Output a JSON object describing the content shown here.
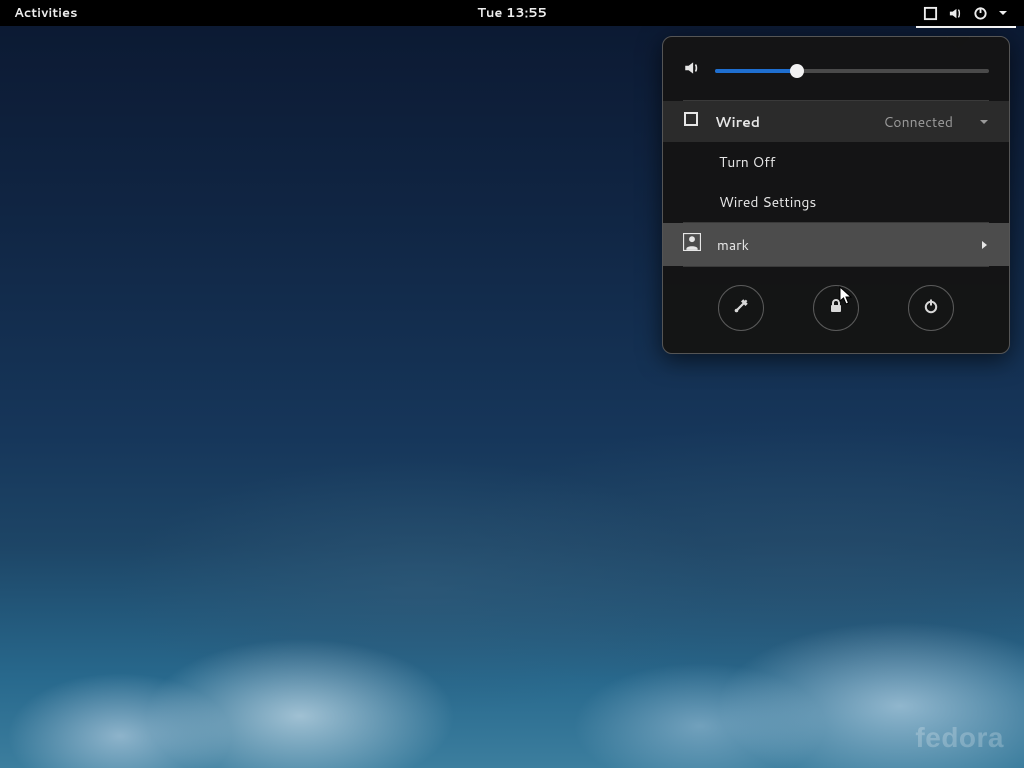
{
  "top_bar": {
    "activities_label": "Activities",
    "clock_text": "Tue 13:55",
    "tray_icons": [
      "network-icon",
      "volume-icon",
      "power-icon",
      "chevron-down-icon"
    ]
  },
  "system_menu": {
    "volume_percent": 30,
    "network": {
      "icon": "network-icon",
      "label": "Wired",
      "status": "Connected",
      "submenu": [
        "Turn Off",
        "Wired Settings"
      ]
    },
    "user": {
      "icon": "user-icon",
      "name": "mark"
    },
    "actions": {
      "settings_icon": "settings-icon",
      "lock_icon": "lock-icon",
      "power_icon": "power-icon"
    }
  },
  "branding": {
    "distro_wordmark": "fedora"
  }
}
